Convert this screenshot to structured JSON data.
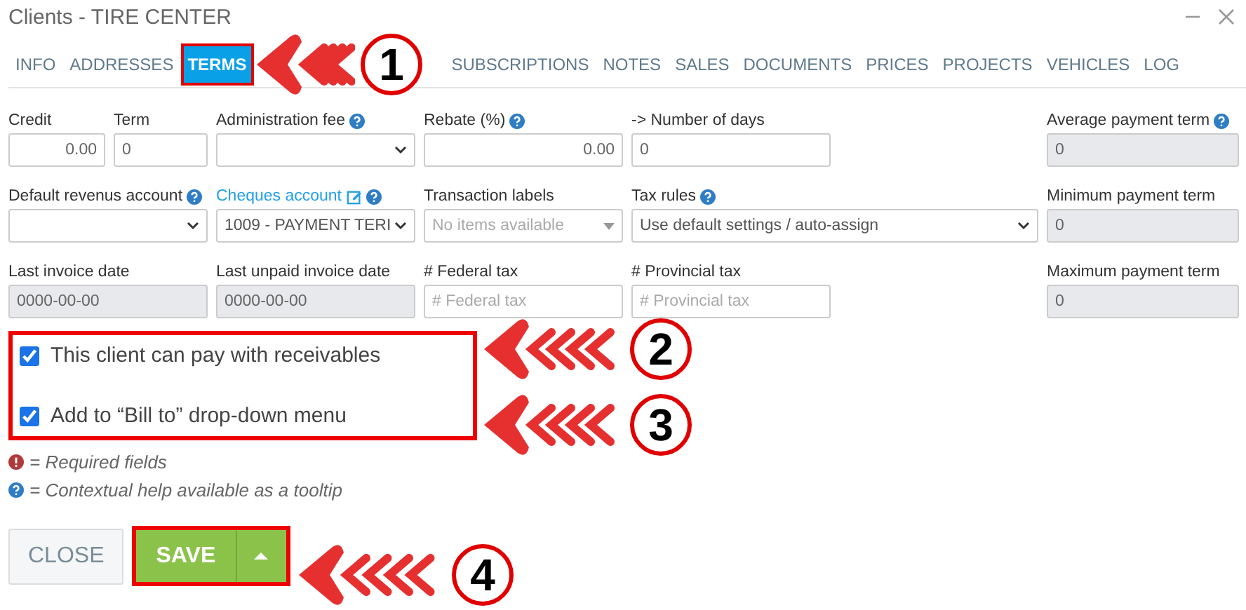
{
  "window": {
    "title": "Clients - TIRE CENTER"
  },
  "tabs": [
    {
      "label": "INFO",
      "selected": false
    },
    {
      "label": "ADDRESSES",
      "selected": false
    },
    {
      "label": "TERMS",
      "selected": true
    },
    {
      "label": "SUBSCRIPTIONS",
      "selected": false
    },
    {
      "label": "NOTES",
      "selected": false
    },
    {
      "label": "SALES",
      "selected": false
    },
    {
      "label": "DOCUMENTS",
      "selected": false
    },
    {
      "label": "PRICES",
      "selected": false
    },
    {
      "label": "PROJECTS",
      "selected": false
    },
    {
      "label": "VEHICLES",
      "selected": false
    },
    {
      "label": "LOG",
      "selected": false
    }
  ],
  "fields": [
    {
      "label": "Credit",
      "kind": "input",
      "value": "0.00"
    },
    {
      "label": "Term",
      "kind": "input",
      "value": "0"
    },
    {
      "label": "Administration fee",
      "kind": "select",
      "help": true
    },
    {
      "label": "Rebate (%)",
      "kind": "input",
      "value": "0.00",
      "help": true
    },
    {
      "label": "-> Number of days",
      "kind": "input",
      "value": "0"
    },
    {
      "label": "Average payment term",
      "kind": "readonly",
      "value": "0",
      "help": true
    },
    {
      "label": "Default revenus account",
      "kind": "select",
      "help": true
    },
    {
      "label": "Cheques account",
      "kind": "select",
      "value": "1009 - PAYMENT TERI",
      "link": true,
      "help": true
    },
    {
      "label": "Transaction labels",
      "kind": "multiselect",
      "placeholder": "No items available"
    },
    {
      "label": "Tax rules",
      "kind": "select",
      "value": "Use default settings / auto-assign",
      "help": true
    },
    {
      "label": "Minimum payment term",
      "kind": "readonly",
      "value": "0"
    },
    {
      "label": "Last invoice date",
      "kind": "readonly",
      "value": "0000-00-00"
    },
    {
      "label": "Last unpaid invoice date",
      "kind": "readonly",
      "value": "0000-00-00"
    },
    {
      "label": "# Federal tax",
      "kind": "input",
      "placeholder": "# Federal tax"
    },
    {
      "label": "# Provincial tax",
      "kind": "input",
      "placeholder": "# Provincial tax"
    },
    {
      "label": "Maximum payment term",
      "kind": "readonly",
      "value": "0"
    }
  ],
  "checkboxes": [
    {
      "label": "This client can pay with receivables",
      "checked": true
    },
    {
      "label": "Add to “Bill to” drop-down menu",
      "checked": true
    }
  ],
  "legend": [
    {
      "kind": "required",
      "text": "= Required fields"
    },
    {
      "kind": "help",
      "text": "= Contextual help available as a tooltip"
    }
  ],
  "buttons": [
    {
      "kind": "close",
      "label": "CLOSE"
    },
    {
      "kind": "save",
      "label": "SAVE"
    }
  ],
  "callouts": [
    {
      "number": "1"
    },
    {
      "number": "2"
    },
    {
      "number": "3"
    },
    {
      "number": "4"
    }
  ]
}
